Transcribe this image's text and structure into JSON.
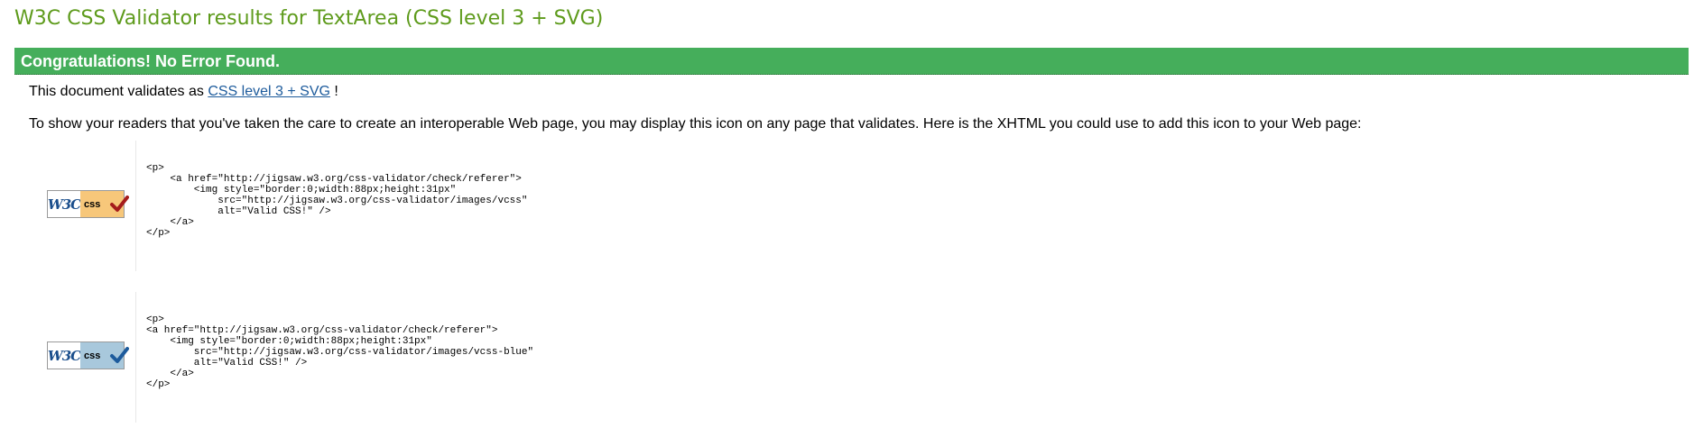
{
  "page": {
    "title": "W3C CSS Validator results for TextArea (CSS level 3 + SVG)"
  },
  "result": {
    "congrats": "Congratulations! No Error Found.",
    "validates_prefix": "This document validates as",
    "validates_link": "CSS level 3 + SVG",
    "validates_suffix": "!",
    "readers_text": "To show your readers that you've taken the care to create an interoperable Web page, you may display this icon on any page that validates. Here is the XHTML you could use to add this icon to your Web page:"
  },
  "badges": [
    {
      "w3c_text": "W3C",
      "css_text": "css",
      "alt": "Valid CSS!",
      "color": "#f7c77a",
      "check_color": "#a51c1c",
      "icon": "valid-css-badge-gold",
      "code": "<p>\n    <a href=\"http://jigsaw.w3.org/css-validator/check/referer\">\n        <img style=\"border:0;width:88px;height:31px\"\n            src=\"http://jigsaw.w3.org/css-validator/images/vcss\"\n            alt=\"Valid CSS!\" />\n    </a>\n</p>"
    },
    {
      "w3c_text": "W3C",
      "css_text": "css",
      "alt": "Valid CSS!",
      "color": "#a8c8dc",
      "check_color": "#1d5b9c",
      "icon": "valid-css-badge-blue",
      "code": "<p>\n<a href=\"http://jigsaw.w3.org/css-validator/check/referer\">\n    <img style=\"border:0;width:88px;height:31px\"\n        src=\"http://jigsaw.w3.org/css-validator/images/vcss-blue\"\n        alt=\"Valid CSS!\" />\n    </a>\n</p>"
    }
  ]
}
